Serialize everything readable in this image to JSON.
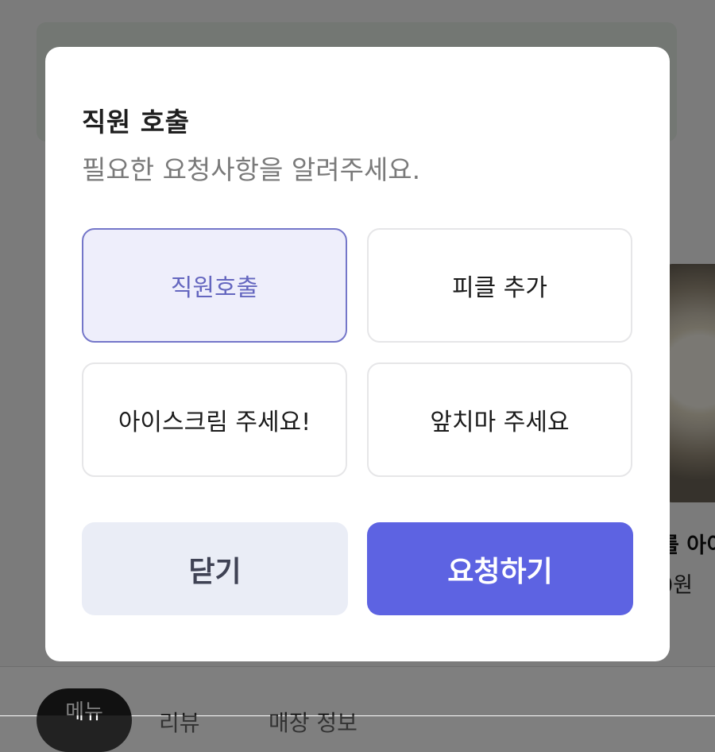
{
  "background": {
    "card_title_fragment": "를 아이",
    "card_price_fragment": "0원",
    "tabs": [
      "메뉴",
      "리뷰",
      "매장 정보"
    ]
  },
  "modal": {
    "title": "직원 호출",
    "subtitle": "필요한 요청사항을 알려주세요.",
    "options": [
      {
        "label": "직원호출",
        "selected": true
      },
      {
        "label": "피클 추가",
        "selected": false
      },
      {
        "label": "아이스크림 주세요!",
        "selected": false
      },
      {
        "label": "앞치마 주세요",
        "selected": false
      }
    ],
    "close_label": "닫기",
    "request_label": "요청하기"
  },
  "colors": {
    "accent": "#5d63e2",
    "selected_bg": "#eeeefb",
    "selected_border": "#7476c9",
    "close_bg": "#eaedf6"
  }
}
